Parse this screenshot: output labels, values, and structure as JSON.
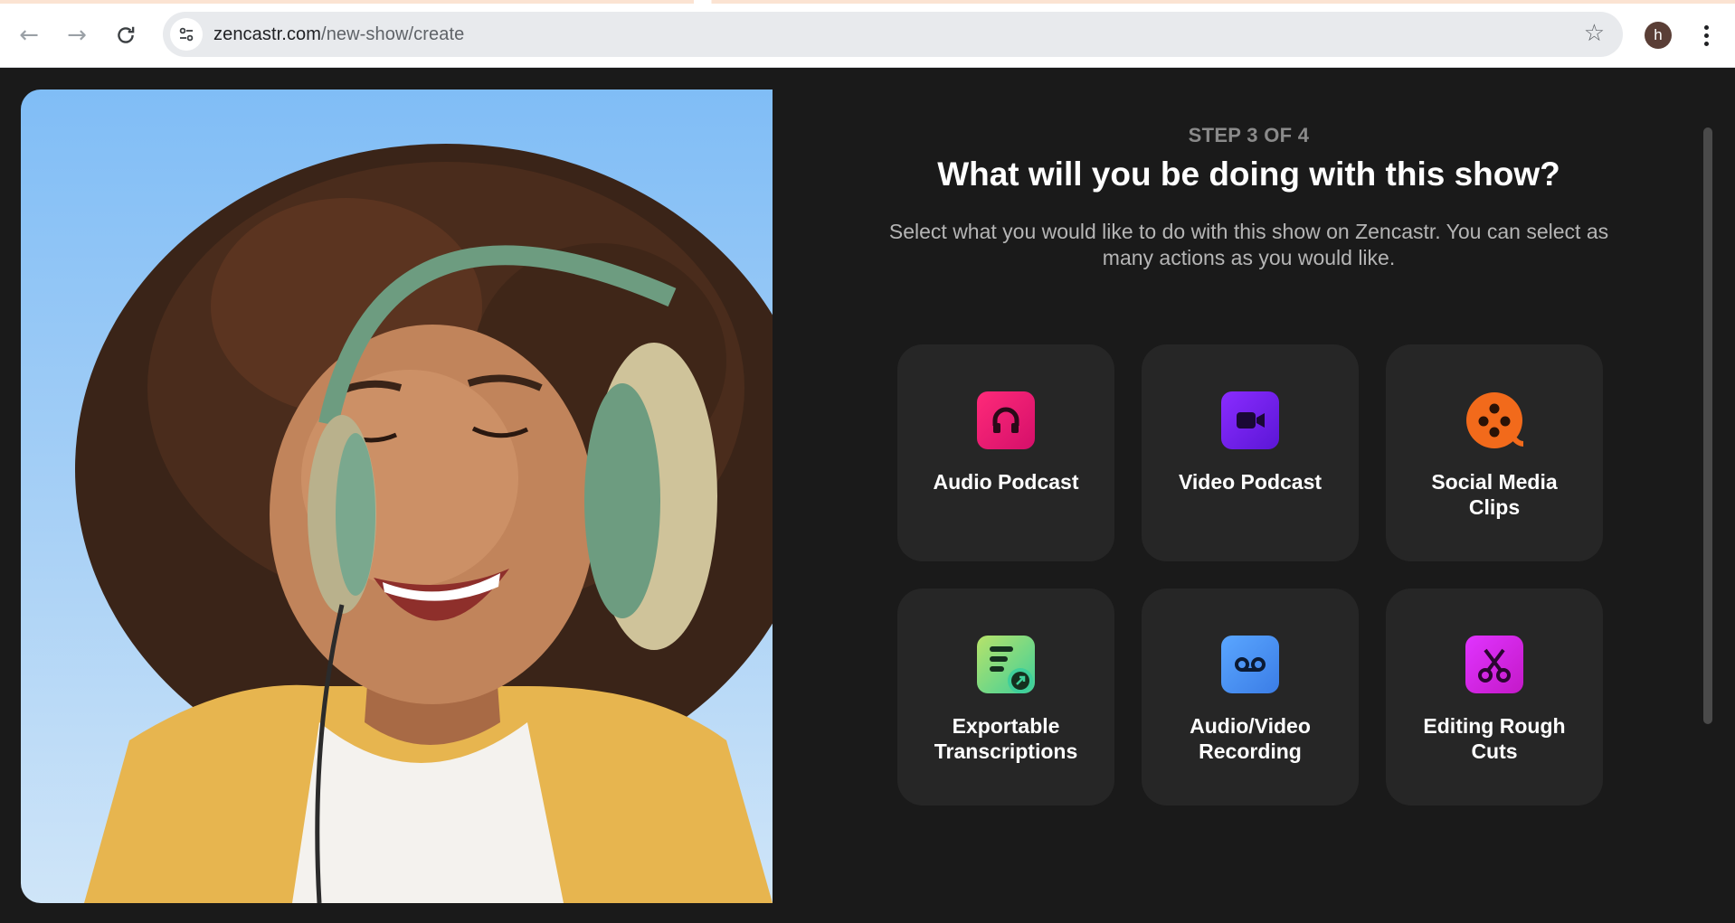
{
  "browser": {
    "url_domain": "zencastr.com",
    "url_path": "/new-show/create",
    "profile_initial": "h"
  },
  "onboarding": {
    "step": "STEP 3 OF 4",
    "title": "What will you be doing with this show?",
    "subtitle": "Select what you would like to do with this show on Zencastr. You can select as many actions as you would like.",
    "options": [
      {
        "label": "Audio Podcast",
        "icon": "headphones-icon",
        "color": "#e8166f"
      },
      {
        "label": "Video Podcast",
        "icon": "video-camera-icon",
        "color": "#6e22ea"
      },
      {
        "label": "Social Media Clips",
        "icon": "film-reel-icon",
        "color": "#f26a1b"
      },
      {
        "label": "Exportable Transcriptions",
        "icon": "transcript-export-icon",
        "color": "#5fd48a"
      },
      {
        "label": "Audio/Video Recording",
        "icon": "voicemail-icon",
        "color": "#4c8ff0"
      },
      {
        "label": "Editing Rough Cuts",
        "icon": "scissors-icon",
        "color": "#d726e6"
      }
    ]
  },
  "colors": {
    "background": "#1a1a1a",
    "card": "#262626"
  }
}
